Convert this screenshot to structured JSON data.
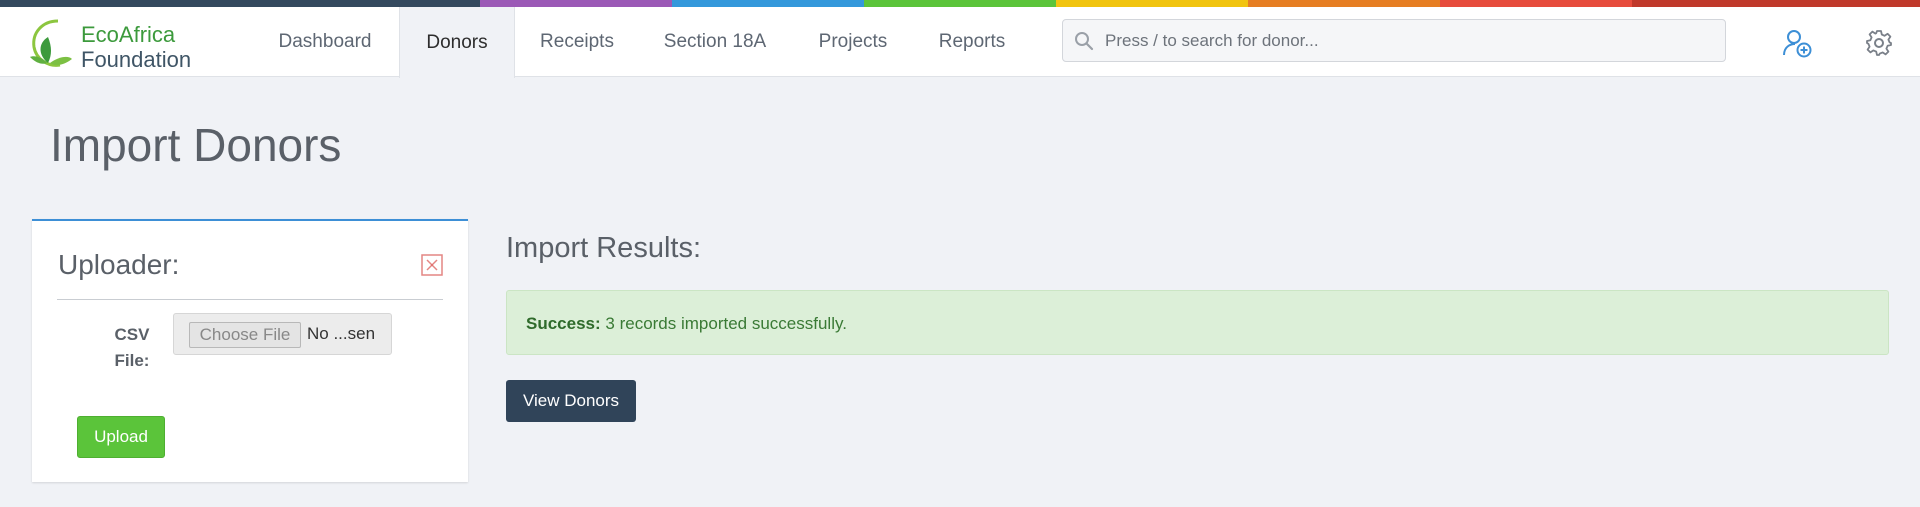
{
  "brand": {
    "line1": "EcoAfrica",
    "line2": "Foundation",
    "top_bar_colors": [
      "#34495e",
      "#9b59b6",
      "#3498db",
      "#5bc43a",
      "#f1c40f",
      "#e67e22",
      "#e74c3c",
      "#c0392b"
    ]
  },
  "nav": {
    "tabs": [
      {
        "label": "Dashboard",
        "active": false
      },
      {
        "label": "Donors",
        "active": true
      },
      {
        "label": "Receipts",
        "active": false
      },
      {
        "label": "Section 18A",
        "active": false
      },
      {
        "label": "Projects",
        "active": false
      },
      {
        "label": "Reports",
        "active": false
      }
    ]
  },
  "search": {
    "placeholder": "Press / to search for donor..."
  },
  "header_icons": [
    "add-user-icon",
    "gear-icon"
  ],
  "page": {
    "title": "Import Donors"
  },
  "uploader": {
    "title": "Uploader:",
    "close_icon": "close-icon",
    "csv_label": "CSV File:",
    "choose_file_label": "Choose File",
    "file_status": "No ...sen",
    "upload_label": "Upload"
  },
  "results": {
    "title": "Import Results:",
    "alert_strong": "Success:",
    "alert_message": " 3 records imported successfully.",
    "view_donors_label": "View Donors"
  },
  "colors": {
    "accent_blue": "#3d8fd6",
    "success_green": "#5bc43a",
    "dark_button": "#304459",
    "alert_bg": "#dcefd8"
  }
}
